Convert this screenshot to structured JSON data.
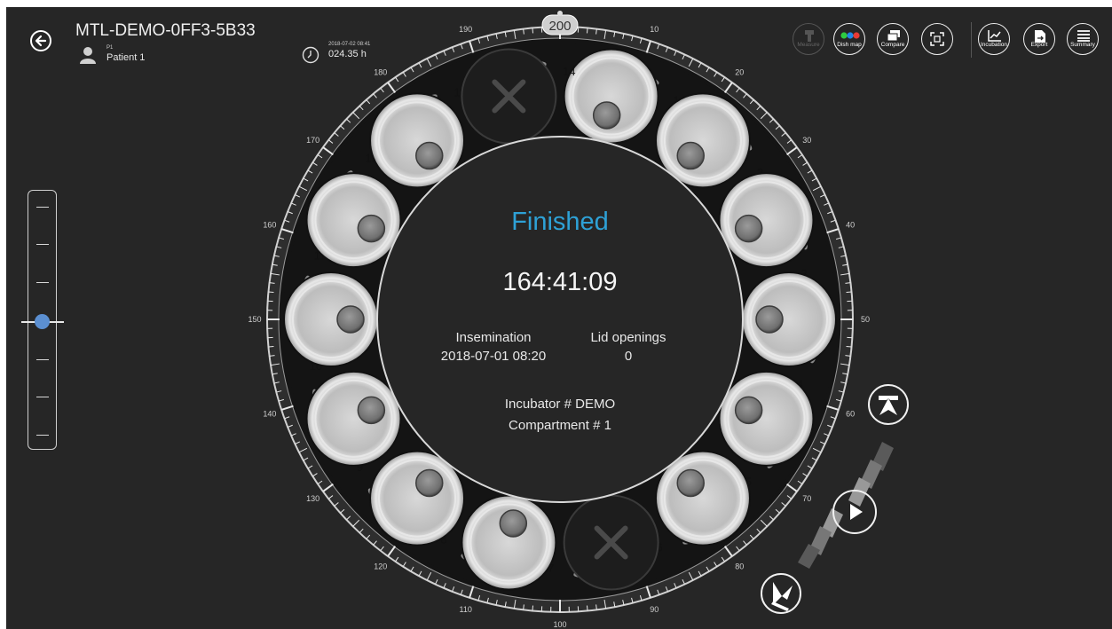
{
  "header": {
    "title": "MTL-DEMO-0FF3-5B33",
    "patient_id": "P1",
    "patient_name": "Patient 1",
    "timestamp": "2018-07-02 08:41",
    "hours": "024.35 h"
  },
  "toolbar": {
    "measure": "Measure",
    "dish_map": "Dish map",
    "compare": "Compare",
    "incubation": "Incubation",
    "export": "Export",
    "summary": "Summary"
  },
  "center": {
    "status": "Finished",
    "elapsed": "164:41:09",
    "insemination_label": "Insemination",
    "insemination_value": "2018-07-01 08:20",
    "lid_label": "Lid openings",
    "lid_value": "0",
    "incubator": "Incubator # DEMO",
    "compartment": "Compartment # 1"
  },
  "dial": {
    "current_value": "200",
    "labels": [
      "10",
      "20",
      "30",
      "40",
      "50",
      "60",
      "70",
      "80",
      "90",
      "100",
      "110",
      "120",
      "130",
      "140",
      "150",
      "160",
      "170",
      "180",
      "190"
    ]
  },
  "wells": [
    "1",
    "2",
    "3",
    "4",
    "5",
    "6",
    "7",
    "8",
    "9",
    "10",
    "11",
    "12",
    "13",
    "14"
  ],
  "colors": {
    "background": "#262626",
    "accent": "#2ea1d6",
    "slider_knob": "#5b8fd1",
    "dish_map_dots": [
      "#2ecc40",
      "#1e88e5",
      "#e53935"
    ]
  },
  "icons": [
    "back-arrow-icon",
    "user-icon",
    "clock-icon",
    "measure-icon",
    "dish-map-icon",
    "compare-icon",
    "fullscreen-icon",
    "incubation-icon",
    "export-icon",
    "summary-icon",
    "play-icon",
    "skip-to-top-icon",
    "skip-to-bottom-icon",
    "empty-well-x-icon"
  ]
}
